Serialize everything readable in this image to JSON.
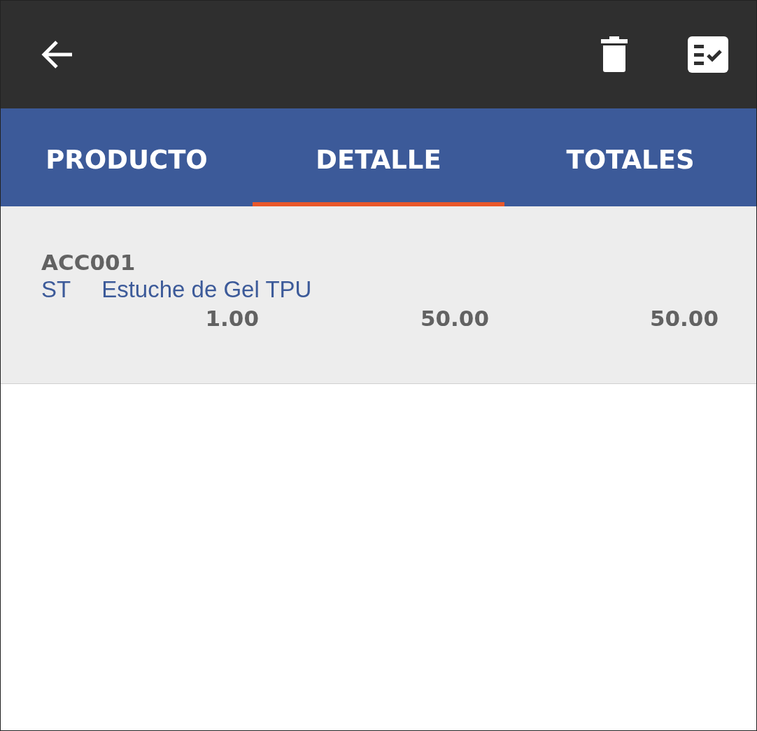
{
  "tabs": [
    {
      "label": "PRODUCTO",
      "selected": false
    },
    {
      "label": "DETALLE",
      "selected": true
    },
    {
      "label": "TOTALES",
      "selected": false
    }
  ],
  "items": [
    {
      "code": "ACC001",
      "unit": "ST",
      "description": "Estuche de Gel TPU",
      "quantity": "1.00",
      "price": "50.00",
      "total": "50.00"
    }
  ]
}
